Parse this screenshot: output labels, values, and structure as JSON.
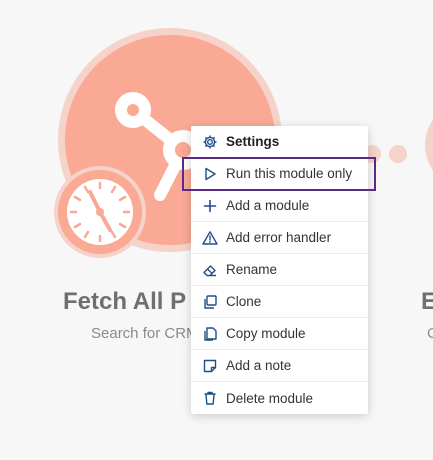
{
  "module": {
    "name": "Fetch All P",
    "description": "Search for CRM",
    "icon": "webhook-icon",
    "badge_icon": "clock-icon"
  },
  "next_module": {
    "name": "E",
    "description": "C"
  },
  "context_menu": {
    "items": [
      {
        "label": "Settings",
        "icon": "gear-icon"
      },
      {
        "label": "Run this module only",
        "icon": "play-icon"
      },
      {
        "label": "Add a module",
        "icon": "plus-icon"
      },
      {
        "label": "Add error handler",
        "icon": "warning-icon"
      },
      {
        "label": "Rename",
        "icon": "eraser-icon"
      },
      {
        "label": "Clone",
        "icon": "clone-icon"
      },
      {
        "label": "Copy module",
        "icon": "copy-icon"
      },
      {
        "label": "Add a note",
        "icon": "note-icon"
      },
      {
        "label": "Delete module",
        "icon": "trash-icon"
      }
    ],
    "highlighted": "Run this module only"
  },
  "colors": {
    "module_fill": "#f9a994",
    "module_halo": "#f6d3ca",
    "highlight_border": "#5b2a86",
    "icon_blue": "#1f4f86"
  }
}
